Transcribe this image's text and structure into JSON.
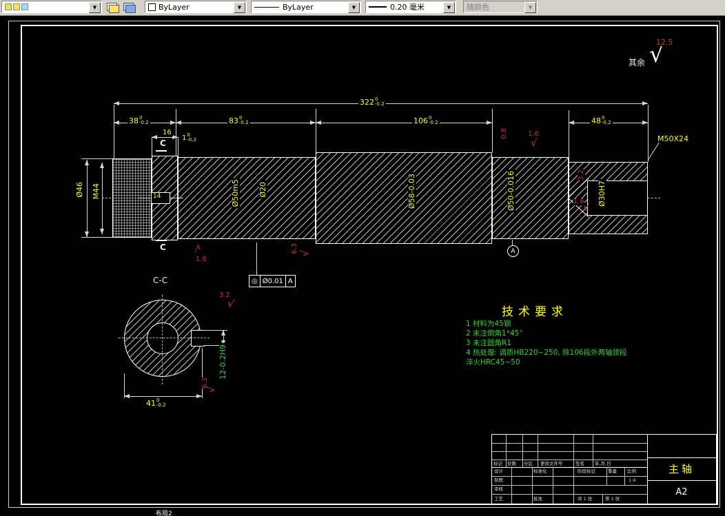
{
  "toolbar": {
    "layer_value": "",
    "color_value": "ByLayer",
    "linetype_value": "ByLayer",
    "lineweight_value": "0.20 毫米",
    "plotstyle_value": "随颜色",
    "dropdown_arrow": "▼"
  },
  "annotation": {
    "surface_default_label": "其余",
    "surface_default_value": "12.5",
    "check": "√",
    "thread_callout": "M50X24",
    "section_label": "C-C",
    "section_letter": "C",
    "gdt": {
      "symbol": "◎",
      "tolerance": "Ø0.01",
      "datum": "A"
    },
    "datum_flag": "A"
  },
  "dims": {
    "overall": {
      "v": "322",
      "tu": "0",
      "tl": "-0.2"
    },
    "seg38": {
      "v": "38",
      "tu": "0",
      "tl": "-0.2"
    },
    "seg83": {
      "v": "83",
      "tu": "0",
      "tl": "-0.2"
    },
    "seg106": {
      "v": "106",
      "tu": "0",
      "tl": "-0.2"
    },
    "seg48": {
      "v": "48",
      "tu": "0",
      "tl": "-0.2"
    },
    "width16": "16",
    "chamfer": {
      "v": "1",
      "tu": "0",
      "tl": "-0.2"
    },
    "keyway14": "14",
    "flat41": {
      "v": "41",
      "tu": "0",
      "tl": "-0.2"
    },
    "keyway12": "12-0.2H9",
    "dia46": "Ø46",
    "m44": "M44",
    "dia50m5": "Ø50m5",
    "dia20": "Ø20",
    "dia58": "Ø58-0.03",
    "dia50b": "Ø50-0.016",
    "dia30": "Ø30H7"
  },
  "roughness": {
    "r08": "0.8",
    "r16a": "1.6",
    "r16b": "1.6",
    "r16c": "1.6",
    "r32a": "3.2",
    "r32b": "3.2",
    "r63a": "6.3",
    "r63b": "6.3"
  },
  "tech": {
    "title": "技术要求",
    "items": [
      "1  材料为45钢",
      "2  未注倒角1*45°",
      "3  未注圆角R1",
      "4  热处理: 调质HB220~250, 除106段外两轴颈段",
      "淬火HRC45~50"
    ]
  },
  "title_block": {
    "part_name": "主轴",
    "format": "A2",
    "mark": "标记",
    "count": "处数",
    "zone": "分区",
    "doc": "更改文件号",
    "sign": "签名",
    "date": "年.月.日",
    "design": "设计",
    "draft": "制图",
    "check": "审核",
    "process": "工艺",
    "standard": "标准化",
    "approve": "批准",
    "stage": "阶段标记",
    "weight": "重量",
    "scale": "比例",
    "scale_value": "1:4",
    "sheets": "共 1 张",
    "page": "第 1 张"
  },
  "statusbar": {
    "layout_tab": "布局2"
  }
}
